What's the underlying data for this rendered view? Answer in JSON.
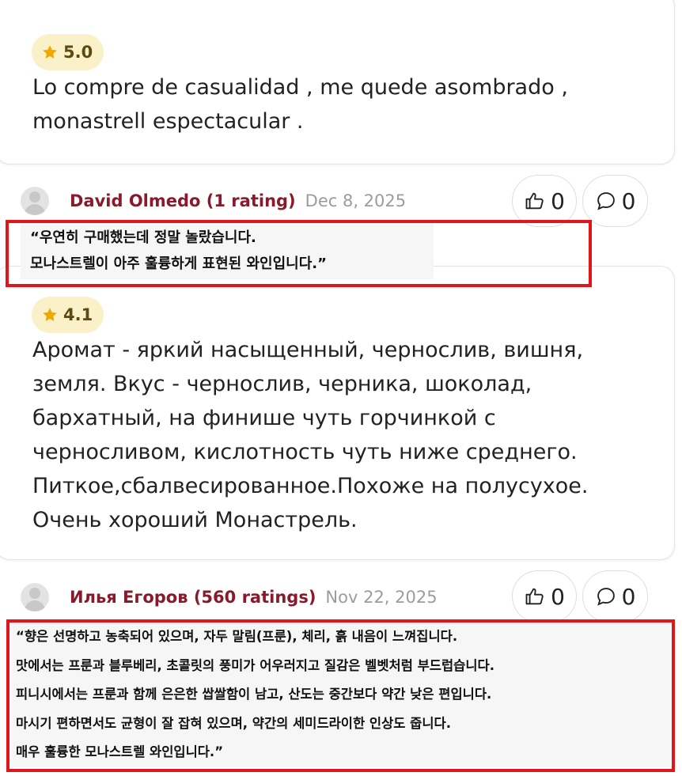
{
  "reviews": [
    {
      "rating": "5.0",
      "text": "Lo compre de casualidad , me quede asombrado , monastrell espectacular ."
    },
    {
      "author": "David Olmedo (1 rating)",
      "date": "Dec 8, 2025",
      "likes": "0",
      "comments": "0",
      "translation": [
        "“우연히 구매했는데 정말 놀랐습니다.",
        "모나스트렐이 아주 훌륭하게 표현된 와인입니다.”"
      ],
      "rating": "4.1",
      "text": "Аромат - яркий насыщенный, чернослив, вишня, земля. Вкус - чернослив, черника, шоколад, бархатный, на финише чуть горчинкой с черносливом, кислотность чуть ниже среднего. Питкое,сбалвесированное.Похоже на полусухое. Очень хороший Монастрель."
    },
    {
      "author": "Илья Егоров (560 ratings)",
      "date": "Nov 22, 2025",
      "likes": "0",
      "comments": "0",
      "translation": [
        "“향은 선명하고 농축되어 있으며, 자두 말림(프룬), 체리, 흙 내음이 느껴집니다.",
        "맛에서는 프룬과 블루베리, 초콜릿의 풍미가 어우러지고 질감은 벨벳처럼 부드럽습니다.",
        "피니시에서는 프룬과 함께 은은한 쌉쌀함이 남고, 산도는 중간보다 약간 낮은 편입니다.",
        "마시기 편하면서도 균형이 잘 잡혀 있으며, 약간의 세미드라이한 인상도 줍니다.",
        "매우 훌륭한 모나스트렐 와인입니다.”"
      ]
    }
  ],
  "colors": {
    "author": "#8a1a2b",
    "star": "#f0a800",
    "badge_bg": "#fbf1c8",
    "highlight_border": "#e0161c"
  },
  "icons": {
    "star": "star-icon",
    "like": "thumbs-up-icon",
    "comment": "comment-bubble-icon",
    "avatar": "user-avatar-icon"
  }
}
